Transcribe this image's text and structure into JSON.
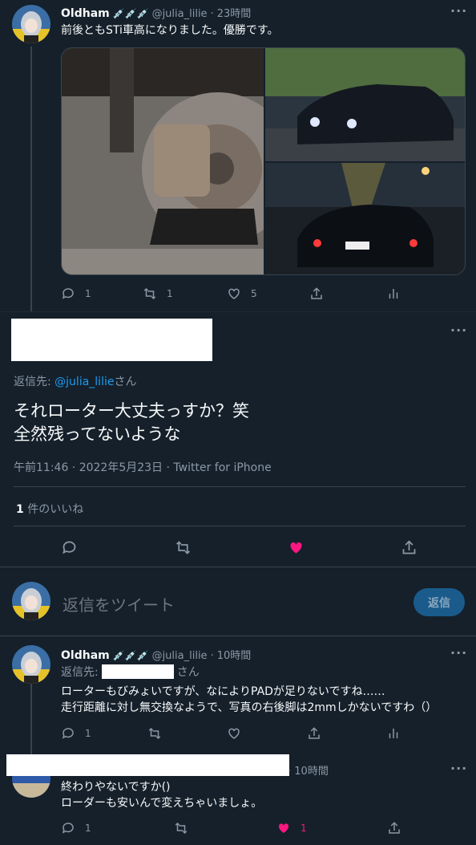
{
  "tweet1": {
    "name": "Oldham",
    "emoji": "💉💉💉",
    "handle": "@julia_lilie",
    "time": "23時間",
    "text": "前後ともSTi車高になりました。優勝です。",
    "replies": "1",
    "retweets": "1",
    "likes": "5"
  },
  "focused": {
    "reply_to_prefix": "返信先: ",
    "reply_to_handle": "@julia_lilie",
    "reply_to_suffix": "さん",
    "text_line1": "それローター大丈夫っすか？笑",
    "text_line2": "全然残ってないような",
    "meta": "午前11:46 · 2022年5月23日 · Twitter for iPhone",
    "likes_count": "1",
    "likes_label": "件のいいね"
  },
  "composer": {
    "placeholder": "返信をツイート",
    "button": "返信"
  },
  "tweet3": {
    "name": "Oldham",
    "emoji": "💉💉💉",
    "handle": "@julia_lilie",
    "time": "10時間",
    "reply_to_prefix": "返信先:",
    "reply_to_suffix": "さん",
    "line1": "ローターもびみょいですが、なによりPADが足りないですね……",
    "line2": "走行距離に対し無交換なようで、写真の右後脚は2mmしかないですわ（）",
    "replies": "1"
  },
  "tweet4": {
    "time": "10時間",
    "line1": "終わりやないですか()",
    "line2": "ローダーも安いんで変えちゃいましょ。",
    "replies": "1",
    "likes": "1"
  },
  "colors": {
    "bg": "#15202b",
    "accent": "#1d9bf0",
    "like": "#f91880",
    "muted": "#8b98a5"
  }
}
